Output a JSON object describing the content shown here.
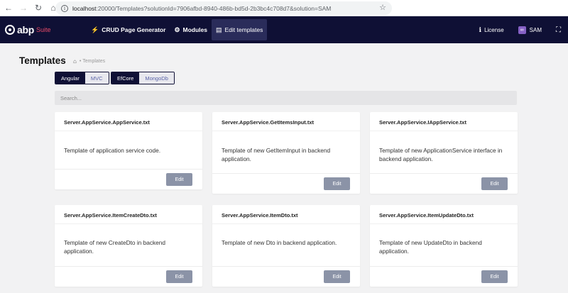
{
  "browser": {
    "url_host": "localhost",
    "url_path": ":20000/Templates?solutionId=7906afbd-8940-486b-bd5d-2b3bc4c708d7&solution=SAM"
  },
  "navbar": {
    "brand": "abp",
    "brand_suffix": "Suite",
    "items": [
      {
        "label": "CRUD Page Generator",
        "icon": "bolt-icon"
      },
      {
        "label": "Modules",
        "icon": "cogs-icon"
      },
      {
        "label": "Edit templates",
        "icon": "file-icon"
      }
    ],
    "license_label": "License",
    "solution_label": "SAM"
  },
  "page": {
    "title": "Templates",
    "breadcrumb": "Templates"
  },
  "toggles": {
    "ui": [
      "Angular",
      "MVC"
    ],
    "db": [
      "EfCore",
      "MongoDb"
    ]
  },
  "search": {
    "placeholder": "Search..."
  },
  "cards": [
    {
      "title": "Server.AppService.AppService.txt",
      "description": "Template of application service code.",
      "button": "Edit"
    },
    {
      "title": "Server.AppService.GetItemsInput.txt",
      "description": "Template of new GetItemInput in backend application.",
      "button": "Edit"
    },
    {
      "title": "Server.AppService.IAppService.txt",
      "description": "Template of new ApplicationService interface in backend application.",
      "button": "Edit"
    },
    {
      "title": "Server.AppService.ItemCreateDto.txt",
      "description": "Template of new CreateDto in backend application.",
      "button": "Edit"
    },
    {
      "title": "Server.AppService.ItemDto.txt",
      "description": "Template of new Dto in backend application.",
      "button": "Edit"
    },
    {
      "title": "Server.AppService.ItemUpdateDto.txt",
      "description": "Template of new UpdateDto in backend application.",
      "button": "Edit"
    }
  ]
}
